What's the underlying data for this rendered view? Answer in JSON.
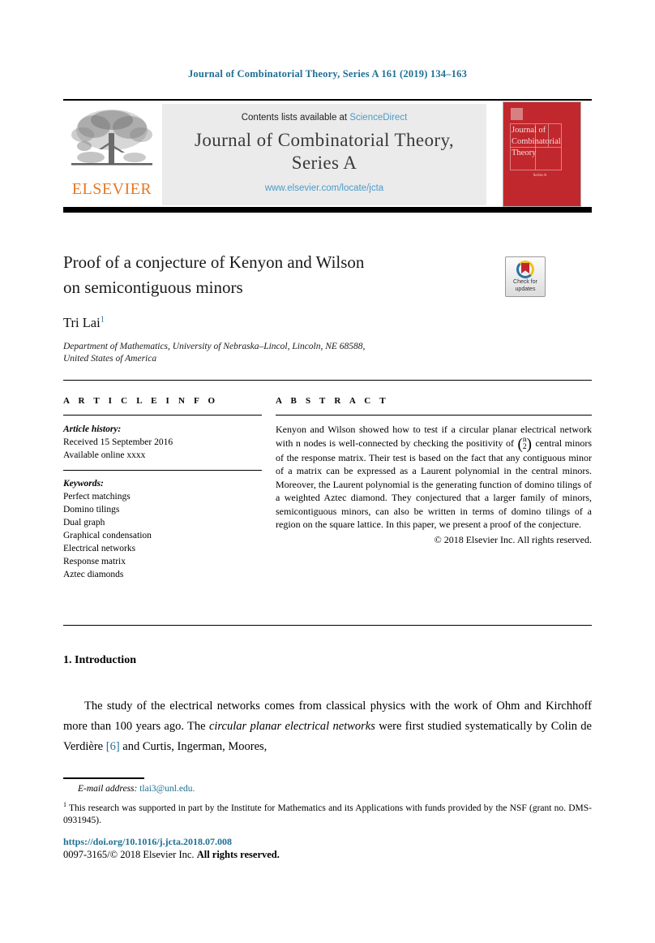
{
  "running_head": "Journal of Combinatorial Theory, Series A 161 (2019) 134–163",
  "masthead": {
    "contents_prefix": "Contents lists available at ",
    "contents_link": "ScienceDirect",
    "journal_name_line1": "Journal of Combinatorial Theory,",
    "journal_name_line2": "Series A",
    "journal_url": "www.elsevier.com/locate/jcta",
    "publisher_wordmark": "ELSEVIER",
    "cover": {
      "title_line1": "Journal of",
      "title_line2": "Combinatorial",
      "title_line3": "Theory",
      "subtitle": "Series A"
    }
  },
  "article": {
    "title_line1": "Proof of a conjecture of Kenyon and Wilson",
    "title_line2": "on semicontiguous minors",
    "crossmark_line1": "Check for",
    "crossmark_line2": "updates",
    "author": "Tri Lai",
    "author_footnote_marker": "1",
    "affiliation_line1": "Department of Mathematics, University of Nebraska–Lincol, Lincoln, NE 68588,",
    "affiliation_line2": "United States of America"
  },
  "info_column": {
    "heading": "A R T I C L E   I N F O",
    "history_heading": "Article history:",
    "history_lines": [
      "Received 15 September 2016",
      "Available online xxxx"
    ],
    "keywords_heading": "Keywords:",
    "keywords": [
      "Perfect matchings",
      "Domino tilings",
      "Dual graph",
      "Graphical condensation",
      "Electrical networks",
      "Response matrix",
      "Aztec diamonds"
    ]
  },
  "abstract": {
    "heading": "A B S T R A C T",
    "text_part1": "Kenyon and Wilson showed how to test if a circular planar electrical network with n nodes is well-connected by checking the positivity of ",
    "binom_top": "n",
    "binom_bottom": "2",
    "text_part2": " central minors of the response matrix. Their test is based on the fact that any contiguous minor of a matrix can be expressed as a Laurent polynomial in the central minors. Moreover, the Laurent polynomial is the generating function of domino tilings of a weighted Aztec diamond. They conjectured that a larger family of minors, semicontiguous minors, can also be written in terms of domino tilings of a region on the square lattice. In this paper, we present a proof of the conjecture.",
    "copyright": "© 2018 Elsevier Inc. All rights reserved."
  },
  "introduction": {
    "heading": "1.  Introduction",
    "text_part1": "The study of the electrical networks comes from classical physics with the work of Ohm and Kirchhoff more than 100 years ago. The ",
    "italic_phrase": "circular planar electrical networks",
    "text_part2": " were first studied systematically by Colin de Verdière ",
    "citation": "[6]",
    "text_part3": " and Curtis, Ingerman, Moores,"
  },
  "footnotes": {
    "email_label": "E-mail address:",
    "email": "tlai3@unl.edu",
    "email_period": ".",
    "note_marker": "1",
    "note_text": "This research was supported in part by the Institute for Mathematics and its Applications with funds provided by the NSF (grant no. DMS-0931945)."
  },
  "footer": {
    "doi": "https://doi.org/10.1016/j.jcta.2018.07.008",
    "issn_prefix": "0097-3165/© 2018 Elsevier Inc.",
    "issn_suffix": "All rights reserved."
  },
  "colors": {
    "link_blue": "#1f6f94",
    "sd_blue": "#4a9cc7",
    "elsevier_orange": "#e87722",
    "cover_red": "#c1282d"
  }
}
